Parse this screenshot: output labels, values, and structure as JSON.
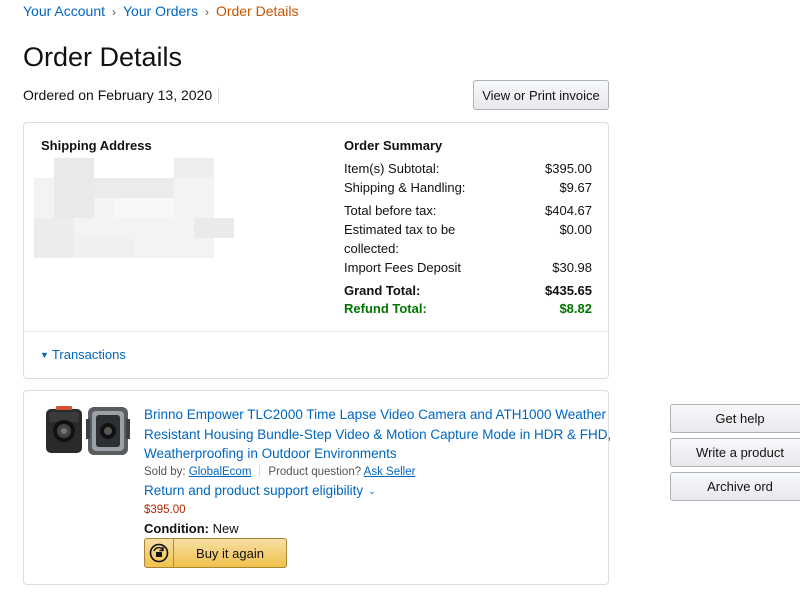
{
  "breadcrumb": {
    "your_account": "Your Account",
    "your_orders": "Your Orders",
    "order_details": "Order Details"
  },
  "page_title": "Order Details",
  "ordered_on": "Ordered on February 13, 2020",
  "invoice_button": "View or Print invoice",
  "shipping": {
    "heading": "Shipping Address"
  },
  "order_summary": {
    "heading": "Order Summary",
    "rows": [
      {
        "label": "Item(s) Subtotal:",
        "value": "$395.00"
      },
      {
        "label": "Shipping & Handling:",
        "value": "$9.67"
      },
      {
        "label": "Total before tax:",
        "value": "$404.67"
      },
      {
        "label": "Estimated tax to be collected:",
        "value": "$0.00"
      },
      {
        "label": "Import Fees Deposit",
        "value": "$30.98"
      },
      {
        "label": "Grand Total:",
        "value": "$435.65"
      },
      {
        "label": "Refund Total:",
        "value": "$8.82"
      }
    ],
    "refund_color": "#007600"
  },
  "transactions_link": "Transactions",
  "item": {
    "title": "Brinno Empower TLC2000 Time Lapse Video Camera and ATH1000 Weather Resistant Housing Bundle-Step Video & Motion Capture Mode in HDR & FHD, Weatherproofing in Outdoor Environments",
    "sold_by_label": "Sold by:",
    "seller": "GlobalEcom",
    "product_question": "Product question?",
    "ask_seller": "Ask Seller",
    "return_eligibility": "Return and product support eligibility",
    "price": "$395.00",
    "condition_label": "Condition:",
    "condition_value": "New",
    "buy_again": "Buy it again",
    "buy_again_icon": "reorder-icon"
  },
  "side_buttons": {
    "get_help": "Get help",
    "write_review": "Write a product",
    "archive_order": "Archive ord"
  },
  "colors": {
    "link": "#0066c0",
    "current_breadcrumb": "#c45500",
    "price": "#b12704",
    "buy_button": "#f0c14b"
  }
}
